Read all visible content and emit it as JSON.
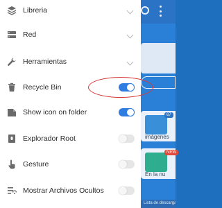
{
  "drawer": {
    "items": [
      {
        "label": "Libreria",
        "icon": "library-icon",
        "control": "chevron"
      },
      {
        "label": "Red",
        "icon": "network-icon",
        "control": "chevron"
      },
      {
        "label": "Herramientas",
        "icon": "wrench-icon",
        "control": "chevron"
      },
      {
        "label": "Recycle Bin",
        "icon": "trash-icon",
        "control": "toggle",
        "enabled": true
      },
      {
        "label": "Show icon on folder",
        "icon": "folder-icon",
        "control": "toggle",
        "enabled": true
      },
      {
        "label": "Explorador Root",
        "icon": "root-icon",
        "control": "toggle",
        "enabled": false
      },
      {
        "label": "Gesture",
        "icon": "gesture-icon",
        "control": "toggle",
        "enabled": false
      },
      {
        "label": "Mostrar Archivos Ocultos",
        "icon": "hidden-files-icon",
        "control": "toggle",
        "enabled": false
      }
    ]
  },
  "background": {
    "tiles": [
      {
        "caption": "imágenes",
        "badge": "67"
      },
      {
        "caption": "En la nu",
        "badge": "NEW"
      }
    ],
    "bottom_chip": "Lista de descargas"
  },
  "colors": {
    "accent": "#2f7de1",
    "annotation": "#d93a3a",
    "background_app": "#2a7fd6"
  }
}
